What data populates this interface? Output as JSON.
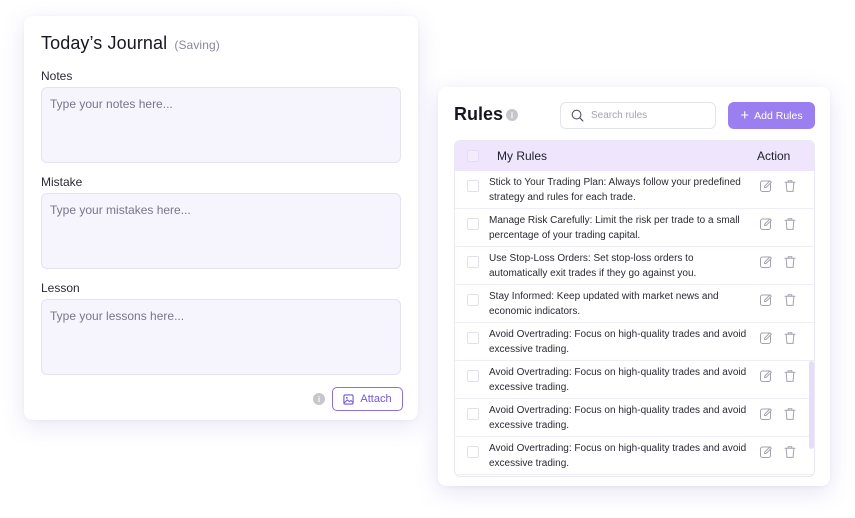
{
  "journal": {
    "title": "Today’s Journal",
    "status": "(Saving)",
    "notes": {
      "label": "Notes",
      "placeholder": "Type your notes here..."
    },
    "mistake": {
      "label": "Mistake",
      "placeholder": "Type your mistakes here..."
    },
    "lesson": {
      "label": "Lesson",
      "placeholder": "Type your lessons here..."
    },
    "info_icon": "info-icon",
    "attach_label": "Attach"
  },
  "rules": {
    "title": "Rules",
    "search_placeholder": "Search rules",
    "add_label": "Add Rules",
    "columns": {
      "rules": "My Rules",
      "action": "Action"
    },
    "items": [
      "Stick to Your Trading Plan: Always follow your predefined strategy and rules for each trade.",
      "Manage Risk Carefully: Limit the risk per trade to a small percentage of your trading capital.",
      "Use Stop-Loss Orders: Set stop-loss orders to automatically exit trades if they go against you.",
      "Stay Informed: Keep updated with market news and economic indicators.",
      "Avoid Overtrading: Focus on high-quality trades and avoid excessive trading.",
      "Avoid Overtrading: Focus on high-quality trades and avoid excessive trading.",
      "Avoid Overtrading: Focus on high-quality trades and avoid excessive trading.",
      "Avoid Overtrading: Focus on high-quality trades and avoid excessive trading."
    ]
  },
  "colors": {
    "accent": "#9b7ff0",
    "accent_text": "#7357d6",
    "header_bg": "#efe6fd",
    "field_bg": "#f6f4fd"
  }
}
